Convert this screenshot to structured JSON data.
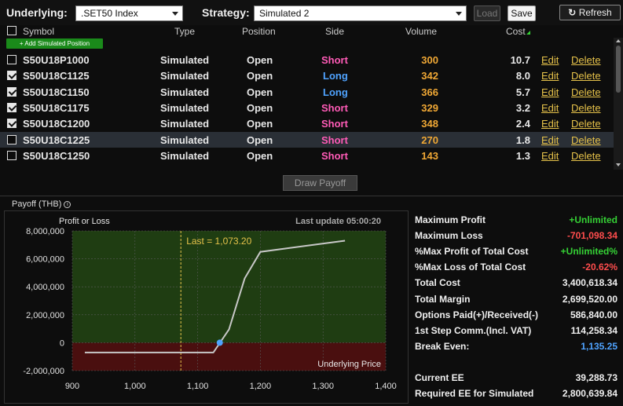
{
  "toolbar": {
    "underlying_label": "Underlying:",
    "underlying_value": ".SET50 Index",
    "strategy_label": "Strategy:",
    "strategy_value": "Simulated 2",
    "load_label": "Load",
    "save_label": "Save",
    "refresh_label": "Refresh"
  },
  "table": {
    "headers": {
      "symbol": "Symbol",
      "type": "Type",
      "position": "Position",
      "side": "Side",
      "volume": "Volume",
      "cost": "Cost"
    },
    "add_label": "+ Add Simulated Position",
    "edit_label": "Edit",
    "delete_label": "Delete",
    "rows": [
      {
        "checked": false,
        "symbol": "S50U18P1000",
        "type": "Simulated",
        "position": "Open",
        "side": "Short",
        "volume": "300",
        "cost": "10.7"
      },
      {
        "checked": true,
        "symbol": "S50U18C1125",
        "type": "Simulated",
        "position": "Open",
        "side": "Long",
        "volume": "342",
        "cost": "8.0"
      },
      {
        "checked": true,
        "symbol": "S50U18C1150",
        "type": "Simulated",
        "position": "Open",
        "side": "Long",
        "volume": "366",
        "cost": "5.7"
      },
      {
        "checked": true,
        "symbol": "S50U18C1175",
        "type": "Simulated",
        "position": "Open",
        "side": "Short",
        "volume": "329",
        "cost": "3.2"
      },
      {
        "checked": true,
        "symbol": "S50U18C1200",
        "type": "Simulated",
        "position": "Open",
        "side": "Short",
        "volume": "348",
        "cost": "2.4"
      },
      {
        "checked": false,
        "symbol": "S50U18C1225",
        "type": "Simulated",
        "position": "Open",
        "side": "Short",
        "volume": "270",
        "cost": "1.8",
        "highlighted": true
      },
      {
        "checked": false,
        "symbol": "S50U18C1250",
        "type": "Simulated",
        "position": "Open",
        "side": "Short",
        "volume": "143",
        "cost": "1.3"
      }
    ]
  },
  "draw_payoff_label": "Draw Payoff",
  "payoff": {
    "title": "Payoff (THB)",
    "info_icon": "info-icon"
  },
  "chart_data": {
    "type": "line",
    "ylabel": "Profit or Loss",
    "xlabel": "Underlying Price",
    "last_update": "Last update 05:00:20",
    "last_marker_label": "Last = 1,073.20",
    "last_value": 1073.2,
    "break_even": 1135.25,
    "xlim": [
      900,
      1400
    ],
    "ylim": [
      -2000000,
      8000000
    ],
    "x_ticks": [
      "900",
      "1,000",
      "1,100",
      "1,200",
      "1,300",
      "1,400"
    ],
    "x_tick_values": [
      900,
      1000,
      1100,
      1200,
      1300,
      1400
    ],
    "y_ticks": [
      "8,000,000",
      "6,000,000",
      "4,000,000",
      "2,000,000",
      "0",
      "-2,000,000"
    ],
    "y_tick_values": [
      8000000,
      6000000,
      4000000,
      2000000,
      0,
      -2000000
    ],
    "series": [
      {
        "x": [
          920,
          1125,
          1150,
          1175,
          1200,
          1335
        ],
        "y": [
          -701098,
          -701098,
          950000,
          4600000,
          6500000,
          7300000
        ]
      }
    ],
    "colors": {
      "profit_bg": "#1f3d12",
      "loss_bg": "#4a0f0f",
      "line": "#c8c8c8",
      "marker": "#4fa3ff",
      "last_line": "#e6c24a"
    }
  },
  "stats": [
    {
      "label": "Maximum Profit",
      "value": "+Unlimited",
      "tone": "green"
    },
    {
      "label": "Maximum Loss",
      "value": "-701,098.34",
      "tone": "red"
    },
    {
      "label": "%Max Profit of Total Cost",
      "value": "+Unlimited%",
      "tone": "green"
    },
    {
      "label": "%Max Loss of Total Cost",
      "value": "-20.62%",
      "tone": "red"
    },
    {
      "label": "Total Cost",
      "value": "3,400,618.34",
      "tone": ""
    },
    {
      "label": "Total Margin",
      "value": "2,699,520.00",
      "tone": ""
    },
    {
      "label": "Options Paid(+)/Received(-)",
      "value": "586,840.00",
      "tone": ""
    },
    {
      "label": "1st Step Comm.(Incl. VAT)",
      "value": "114,258.34",
      "tone": ""
    },
    {
      "label": "Break Even:",
      "value": "1,135.25",
      "tone": "blue"
    },
    {
      "label": "Current EE",
      "value": "39,288.73",
      "tone": ""
    },
    {
      "label": "Required EE for Simulated",
      "value": "2,800,639.84",
      "tone": ""
    }
  ]
}
